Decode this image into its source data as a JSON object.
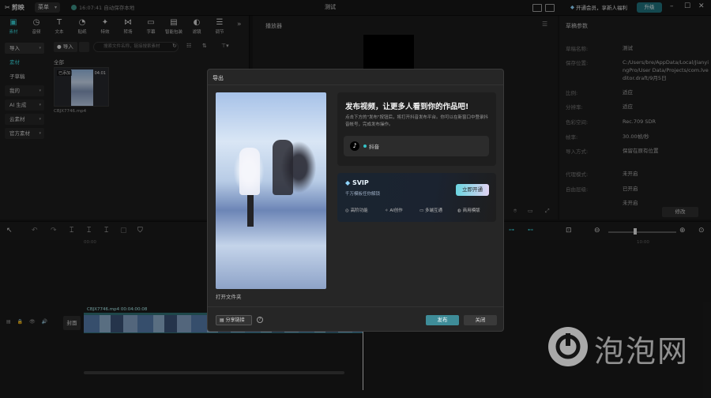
{
  "app": {
    "logo_text": "剪映",
    "menu_label": "菜单",
    "autosave": "16:07:41 自动保存本地",
    "title": "测试",
    "vip_promo": "开通会员，享新人福利",
    "upgrade": "升级"
  },
  "toolbar": {
    "tools": [
      {
        "label": "素材",
        "icon": "folder-icon"
      },
      {
        "label": "音频",
        "icon": "audio-icon"
      },
      {
        "label": "文本",
        "icon": "text-icon"
      },
      {
        "label": "贴纸",
        "icon": "sticker-icon"
      },
      {
        "label": "特效",
        "icon": "effect-icon"
      },
      {
        "label": "转场",
        "icon": "transition-icon"
      },
      {
        "label": "字幕",
        "icon": "subtitle-icon"
      },
      {
        "label": "智能包装",
        "icon": "smart-pack-icon"
      },
      {
        "label": "滤镜",
        "icon": "filter-icon"
      },
      {
        "label": "调节",
        "icon": "adjust-icon"
      }
    ]
  },
  "sidebar": {
    "items": [
      {
        "label": "导入"
      },
      {
        "label": "素材"
      },
      {
        "label": "子草稿"
      },
      {
        "label": "我的"
      },
      {
        "label": "AI 生成"
      },
      {
        "label": "云素材"
      },
      {
        "label": "官方素材"
      }
    ]
  },
  "media": {
    "import_label": "导入",
    "search_placeholder": "搜索文件名称，链接搜索素材",
    "section_label": "全部",
    "item_added": "已添加",
    "item_duration": "04:01",
    "item_name": "CBJX7746.mp4"
  },
  "player": {
    "label": "播放器"
  },
  "draft": {
    "label": "草稿参数",
    "rows": [
      {
        "key": "草稿名称:",
        "value": "测试"
      },
      {
        "key": "保存位置:",
        "value": "C:/Users/bre/AppData/Local/JianyingPro/User Data/Projects/com.lveditor.draft/9月5日"
      },
      {
        "key": "比例:",
        "value": "适应"
      },
      {
        "key": "分辨率:",
        "value": "适应"
      },
      {
        "key": "色彩空间:",
        "value": "Rec.709 SDR"
      },
      {
        "key": "帧率:",
        "value": "30.00帧/秒"
      },
      {
        "key": "导入方式:",
        "value": "保留在原有位置"
      },
      {
        "key": "代理模式:",
        "value": "未开启"
      },
      {
        "key": "自由层级:",
        "value": "已开启"
      },
      {
        "key": "",
        "value": "未开启"
      }
    ],
    "edit_label": "修改"
  },
  "timeline": {
    "ruler": [
      "00:00",
      "10:00"
    ],
    "clip_info": "CBJX7746.mp4  00:04:00:08",
    "cover_label": "封面"
  },
  "export_dialog": {
    "title": "导出",
    "open_folder": "打开文件夹",
    "publish_title": "发布视频，让更多人看到你的作品吧!",
    "publish_desc": "点击下方的\"发布\"按钮后，将打开抖音发布平台。你可以在新窗口中登录抖音帐号，完成发布操作。",
    "platform": "抖音",
    "svip": "SVIP",
    "svip_sub": "千万模板任你解锁",
    "open_vip": "立即开通",
    "features": [
      "高阶功能",
      "AI创作",
      "多端互通",
      "商用模版"
    ],
    "share_label": "分享链接",
    "help": "?",
    "publish_btn": "发布",
    "close_btn": "关闭"
  },
  "watermark": {
    "text": "泡泡网"
  }
}
